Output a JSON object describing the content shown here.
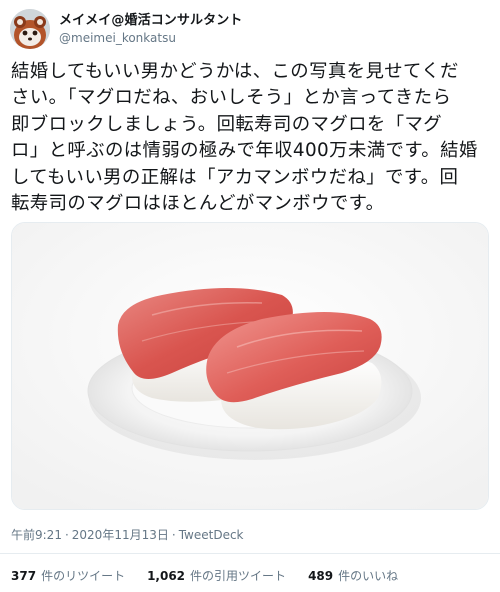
{
  "author": {
    "display_name": "メイメイ@婚活コンサルタント",
    "handle": "@meimei_konkatsu",
    "avatar_icon": "red-panda-avatar"
  },
  "tweet": {
    "text": "結婚してもいい男かどうかは、この写真を見せてくだ\nさい。「マグロだね、おいしそう」とか言ってきたら\n即ブロックしましょう。回転寿司のマグロを「マグ\nロ」と呼ぶのは情弱の極みで年収400万未満です。結婚\nしてもいい男の正解は「アカマンボウだね」です。回\n転寿司のマグロはほとんどがマンボウです。",
    "image_icon": "sushi-photo"
  },
  "meta": {
    "time": "午前9:21",
    "date": "2020年11月13日",
    "source": "TweetDeck",
    "separator": "·"
  },
  "stats": {
    "retweets_count": "377",
    "retweets_label": "件のリツイート",
    "quotes_count": "1,062",
    "quotes_label": "件の引用ツイート",
    "likes_count": "489",
    "likes_label": "件のいいね"
  },
  "colors": {
    "text": "#14171a",
    "secondary": "#657786",
    "divider": "#e6ecf0"
  }
}
